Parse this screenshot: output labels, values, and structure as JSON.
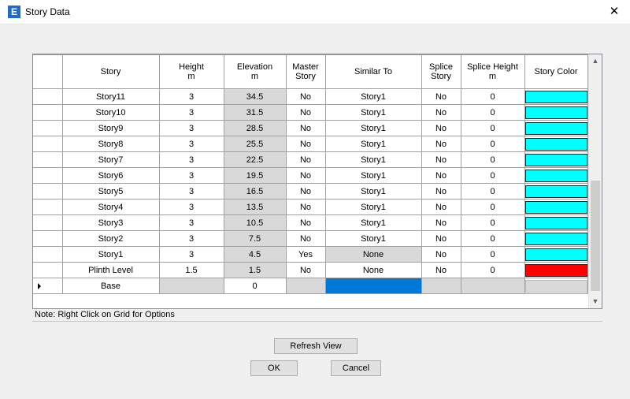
{
  "window": {
    "title": "Story Data",
    "app_icon": "E"
  },
  "grid": {
    "headers": {
      "story": "Story",
      "height": "Height",
      "height_unit": "m",
      "elevation": "Elevation",
      "elevation_unit": "m",
      "master_story_line1": "Master",
      "master_story_line2": "Story",
      "similar_to": "Similar To",
      "splice_story_line1": "Splice",
      "splice_story_line2": "Story",
      "splice_height": "Splice Height",
      "splice_height_unit": "m",
      "story_color": "Story Color"
    },
    "rows": [
      {
        "story": "Story11",
        "height": "3",
        "elevation": "34.5",
        "master": "No",
        "similar": "Story1",
        "splice": "No",
        "splice_height": "0",
        "color": "#00ffff"
      },
      {
        "story": "Story10",
        "height": "3",
        "elevation": "31.5",
        "master": "No",
        "similar": "Story1",
        "splice": "No",
        "splice_height": "0",
        "color": "#00ffff"
      },
      {
        "story": "Story9",
        "height": "3",
        "elevation": "28.5",
        "master": "No",
        "similar": "Story1",
        "splice": "No",
        "splice_height": "0",
        "color": "#00ffff"
      },
      {
        "story": "Story8",
        "height": "3",
        "elevation": "25.5",
        "master": "No",
        "similar": "Story1",
        "splice": "No",
        "splice_height": "0",
        "color": "#00ffff"
      },
      {
        "story": "Story7",
        "height": "3",
        "elevation": "22.5",
        "master": "No",
        "similar": "Story1",
        "splice": "No",
        "splice_height": "0",
        "color": "#00ffff"
      },
      {
        "story": "Story6",
        "height": "3",
        "elevation": "19.5",
        "master": "No",
        "similar": "Story1",
        "splice": "No",
        "splice_height": "0",
        "color": "#00ffff"
      },
      {
        "story": "Story5",
        "height": "3",
        "elevation": "16.5",
        "master": "No",
        "similar": "Story1",
        "splice": "No",
        "splice_height": "0",
        "color": "#00ffff"
      },
      {
        "story": "Story4",
        "height": "3",
        "elevation": "13.5",
        "master": "No",
        "similar": "Story1",
        "splice": "No",
        "splice_height": "0",
        "color": "#00ffff"
      },
      {
        "story": "Story3",
        "height": "3",
        "elevation": "10.5",
        "master": "No",
        "similar": "Story1",
        "splice": "No",
        "splice_height": "0",
        "color": "#00ffff"
      },
      {
        "story": "Story2",
        "height": "3",
        "elevation": "7.5",
        "master": "No",
        "similar": "Story1",
        "splice": "No",
        "splice_height": "0",
        "color": "#00ffff"
      },
      {
        "story": "Story1",
        "height": "3",
        "elevation": "4.5",
        "master": "Yes",
        "similar": "None",
        "splice": "No",
        "splice_height": "0",
        "color": "#00ffff"
      },
      {
        "story": "Plinth Level",
        "height": "1.5",
        "elevation": "1.5",
        "master": "No",
        "similar": "None",
        "splice": "No",
        "splice_height": "0",
        "color": "#ff0000"
      },
      {
        "story": "Base",
        "height": "",
        "elevation": "0",
        "master": "",
        "similar": "",
        "splice": "",
        "splice_height": "",
        "color": ""
      }
    ]
  },
  "colors": {
    "cyan": "#00ffff",
    "red": "#ff0000",
    "selection_blue": "#0078d7",
    "readonly_gray": "#d9d9d9"
  },
  "note": "Note:  Right Click on Grid for Options",
  "buttons": {
    "refresh": "Refresh View",
    "ok": "OK",
    "cancel": "Cancel"
  }
}
